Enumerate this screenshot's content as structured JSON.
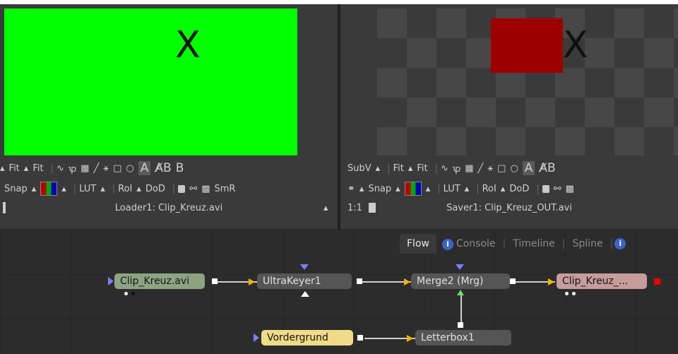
{
  "left_viewer": {
    "toolbar1": [
      "Fit",
      "Fit",
      "A",
      "B"
    ],
    "toolbar2": [
      "Snap",
      "LUT",
      "RoI",
      "DoD",
      "SmR"
    ],
    "status": "Loader1: Clip_Kreuz.avi",
    "image_letter": "X"
  },
  "right_viewer": {
    "toolbar1": [
      "SubV",
      "Fit",
      "Fit",
      "A"
    ],
    "toolbar2": [
      "Snap",
      "LUT",
      "RoI",
      "DoD"
    ],
    "zoom": "1:1",
    "status": "Saver1: Clip_Kreuz_OUT.avi",
    "image_letter": "X"
  },
  "flow": {
    "tabs": [
      "Flow",
      "Console",
      "Timeline",
      "Spline"
    ],
    "nodes": {
      "clip": "Clip_Kreuz.avi",
      "ultrakeyer": "UltraKeyer1",
      "merge": "Merge2 (Mrg)",
      "saver": "Clip_Kreuz_...",
      "vordergrund": "Vordergrund",
      "letterbox": "Letterbox1"
    }
  },
  "colors": {
    "green_image": "#00ff00",
    "red_rect": "#9e0000",
    "node_yellow": "#f0dc88"
  }
}
